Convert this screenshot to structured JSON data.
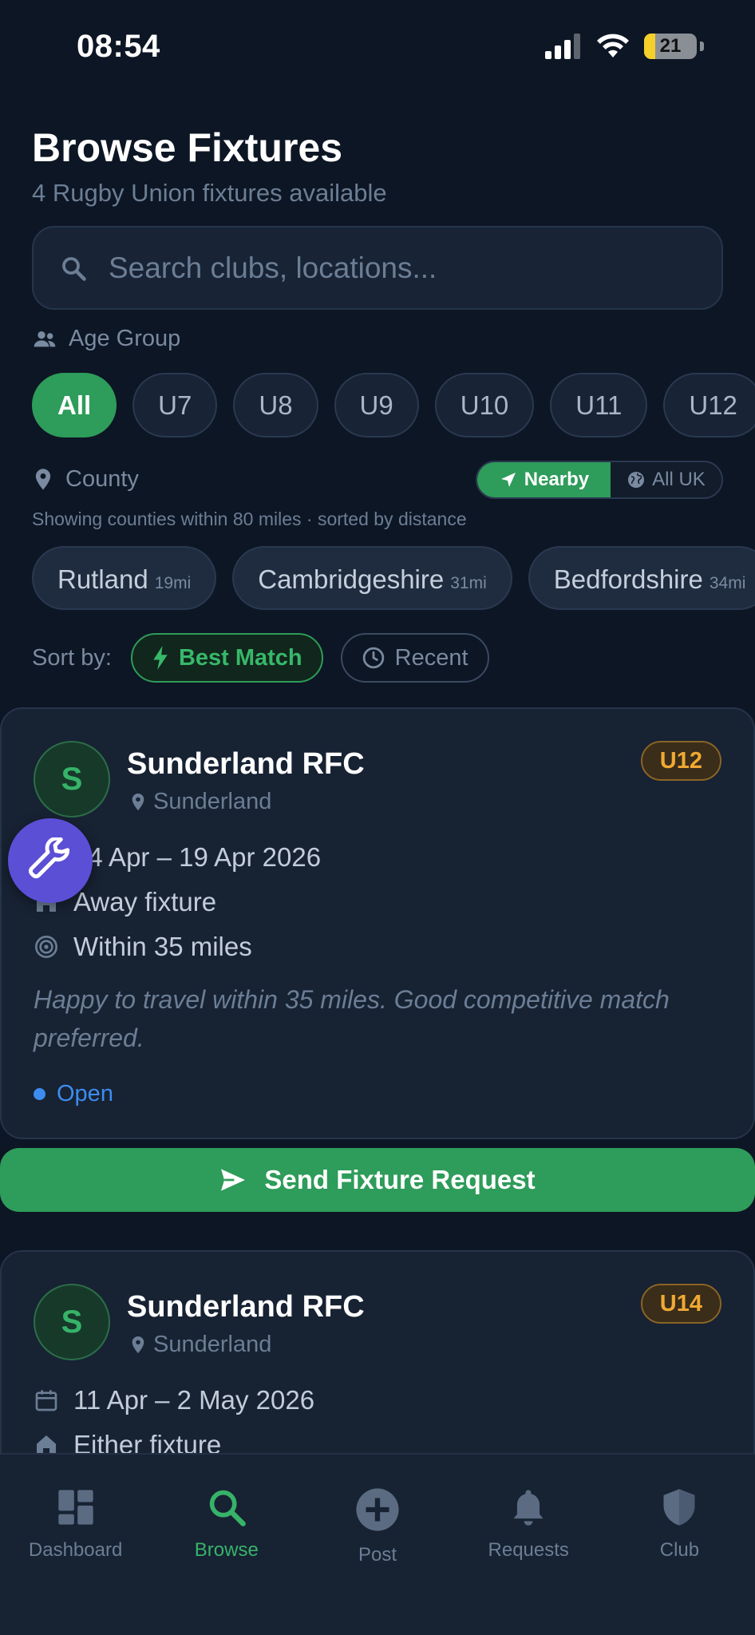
{
  "status_bar": {
    "time": "08:54",
    "battery": "21",
    "battery_level": 0.21
  },
  "header": {
    "title": "Browse Fixtures",
    "subtitle": "4 Rugby Union fixtures available"
  },
  "search": {
    "placeholder": "Search clubs, locations...",
    "value": ""
  },
  "age_group": {
    "label": "Age Group",
    "chips": [
      "All",
      "U7",
      "U8",
      "U9",
      "U10",
      "U11",
      "U12"
    ],
    "selected": "All"
  },
  "county": {
    "label": "County",
    "toggle": {
      "nearby": "Nearby",
      "all_uk": "All UK",
      "selected": "Nearby"
    },
    "hint": "Showing counties within 80 miles · sorted by distance",
    "chips": [
      {
        "name": "Rutland",
        "distance": "19mi"
      },
      {
        "name": "Cambridgeshire",
        "distance": "31mi"
      },
      {
        "name": "Bedfordshire",
        "distance": "34mi"
      }
    ]
  },
  "sort": {
    "label": "Sort by:",
    "best_match": "Best Match",
    "recent": "Recent",
    "selected": "Best Match"
  },
  "fixtures": [
    {
      "initial": "S",
      "club": "Sunderland RFC",
      "location": "Sunderland",
      "age": "U12",
      "dates": "14 Apr – 19 Apr 2026",
      "venue": "Away fixture",
      "radius": "Within 35 miles",
      "note": "Happy to travel within 35 miles. Good competitive match preferred.",
      "status": "Open",
      "action": "Send Fixture Request"
    },
    {
      "initial": "S",
      "club": "Sunderland RFC",
      "location": "Sunderland",
      "age": "U14",
      "dates": "11 Apr – 2 May 2026",
      "venue": "Either fixture"
    }
  ],
  "tabs": [
    {
      "label": "Dashboard",
      "icon": "dashboard-icon"
    },
    {
      "label": "Browse",
      "icon": "search-icon",
      "active": true
    },
    {
      "label": "Post",
      "icon": "plus-circle-icon"
    },
    {
      "label": "Requests",
      "icon": "bell-icon"
    },
    {
      "label": "Club",
      "icon": "shield-icon"
    }
  ],
  "colors": {
    "background": "#0d1624",
    "accent_green": "#2e9c5a",
    "badge_amber": "#f0a933",
    "status_blue": "#3d8df0",
    "fab_purple": "#5b4fd6"
  }
}
